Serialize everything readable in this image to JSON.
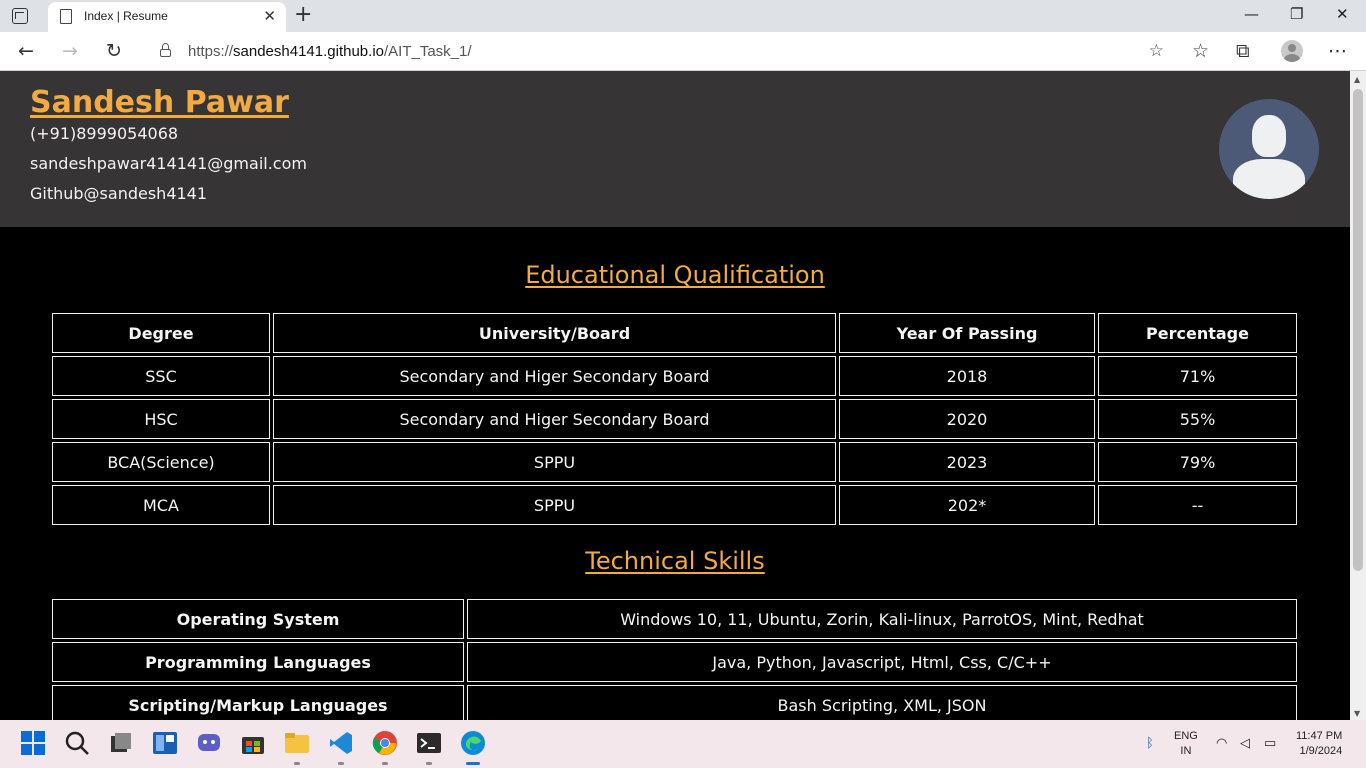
{
  "browser": {
    "tab_title": "Index | Resume",
    "url_prefix": "https://",
    "url_host": "sandesh4141.github.io",
    "url_path": "/AIT_Task_1/"
  },
  "resume": {
    "name": "Sandesh Pawar",
    "phone": "(+91)8999054068",
    "email": "sandeshpawar414141@gmail.com",
    "github": "Github@sandesh4141",
    "accent_color": "#f2aa42",
    "header_bg": "#363435"
  },
  "education": {
    "title": "Educational Qualification",
    "headers": [
      "Degree",
      "University/Board",
      "Year Of Passing",
      "Percentage"
    ],
    "rows": [
      [
        "SSC",
        "Secondary and Higer Secondary Board",
        "2018",
        "71%"
      ],
      [
        "HSC",
        "Secondary and Higer Secondary Board",
        "2020",
        "55%"
      ],
      [
        "BCA(Science)",
        "SPPU",
        "2023",
        "79%"
      ],
      [
        "MCA",
        "SPPU",
        "202*",
        "--"
      ]
    ]
  },
  "skills": {
    "title": "Technical Skills",
    "rows": [
      [
        "Operating System",
        "Windows 10, 11, Ubuntu, Zorin, Kali-linux, ParrotOS, Mint, Redhat"
      ],
      [
        "Programming Languages",
        "Java, Python, Javascript, Html, Css, C/C++"
      ],
      [
        "Scripting/Markup Languages",
        "Bash Scripting, XML, JSON"
      ]
    ]
  },
  "taskbar": {
    "lang_line1": "ENG",
    "lang_line2": "IN",
    "time": "11:47 PM",
    "date": "1/9/2024"
  }
}
